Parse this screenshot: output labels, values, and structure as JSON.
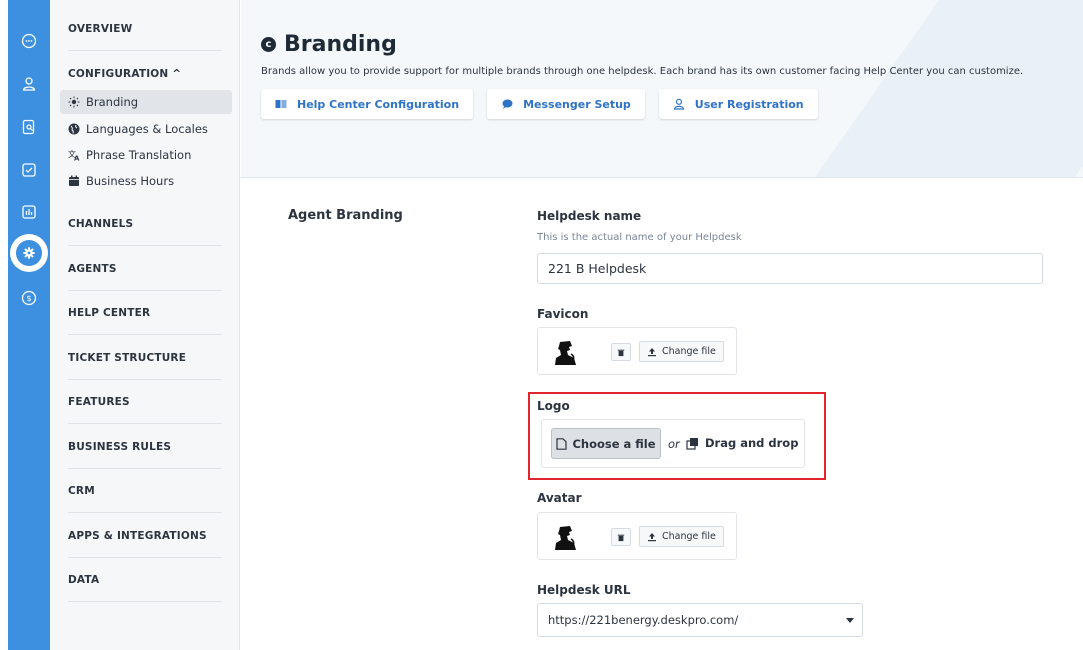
{
  "rail": {
    "icons": [
      "chat-icon",
      "user-icon",
      "search-document-icon",
      "checkbox-icon",
      "report-icon",
      "settings-icon",
      "billing-icon"
    ]
  },
  "sidebar": {
    "overview": "OVERVIEW",
    "configuration": "CONFIGURATION ^",
    "items": [
      {
        "label": "Branding",
        "icon": "sun-icon"
      },
      {
        "label": "Languages & Locales",
        "icon": "globe-icon"
      },
      {
        "label": "Phrase Translation",
        "icon": "translate-icon"
      },
      {
        "label": "Business Hours",
        "icon": "calendar-icon"
      }
    ],
    "sections": [
      "CHANNELS",
      "AGENTS",
      "HELP CENTER",
      "TICKET STRUCTURE",
      "FEATURES",
      "BUSINESS RULES",
      "CRM",
      "APPS & INTEGRATIONS",
      "DATA"
    ]
  },
  "header": {
    "title": "Branding",
    "title_icon_letter": "c",
    "description": "Brands allow you to provide support for multiple brands through one helpdesk. Each brand has its own customer facing Help Center you can customize.",
    "tabs": [
      {
        "label": "Help Center Configuration",
        "icon": "book-icon"
      },
      {
        "label": "Messenger Setup",
        "icon": "message-icon"
      },
      {
        "label": "User Registration",
        "icon": "user-icon"
      }
    ]
  },
  "form": {
    "section": "Agent Branding",
    "helpdesk_name": {
      "label": "Helpdesk name",
      "help": "This is the actual name of your Helpdesk",
      "value": "221 B Helpdesk"
    },
    "favicon": {
      "label": "Favicon",
      "change": "Change file"
    },
    "logo": {
      "label": "Logo",
      "choose": "Choose a file",
      "or": "or",
      "drag": "Drag and drop"
    },
    "avatar": {
      "label": "Avatar",
      "change": "Change file"
    },
    "helpdesk_url": {
      "label": "Helpdesk URL",
      "value": "https://221benergy.deskpro.com/"
    }
  },
  "colors": {
    "rail": "#3d8fe0",
    "link": "#2f73c8",
    "highlight": "#e0262b"
  }
}
